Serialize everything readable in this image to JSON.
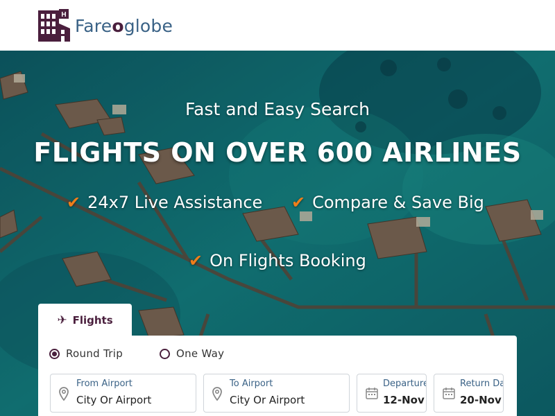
{
  "brand": {
    "name_prefix": "Fare",
    "name_o": "o",
    "name_suffix": "globe",
    "accent_color": "#4a1f3d",
    "secondary_color": "#3a6286"
  },
  "hero": {
    "tagline": "Fast and Easy Search",
    "headline": "FLIGHTS ON OVER 600 AIRLINES",
    "features": [
      "24x7 Live Assistance",
      "Compare & Save Big",
      "On Flights Booking"
    ],
    "check_color": "#f07e1a"
  },
  "search": {
    "tab_label": "Flights",
    "trip_types": [
      "Round Trip",
      "One Way"
    ],
    "selected_trip": "Round Trip",
    "from": {
      "label": "From Airport",
      "value": "City Or Airport"
    },
    "to": {
      "label": "To Airport",
      "value": "City Or Airport"
    },
    "departure": {
      "label": "Departure Date",
      "value": "12-Nov"
    },
    "return": {
      "label": "Return Date",
      "value": "20-Nov"
    }
  }
}
